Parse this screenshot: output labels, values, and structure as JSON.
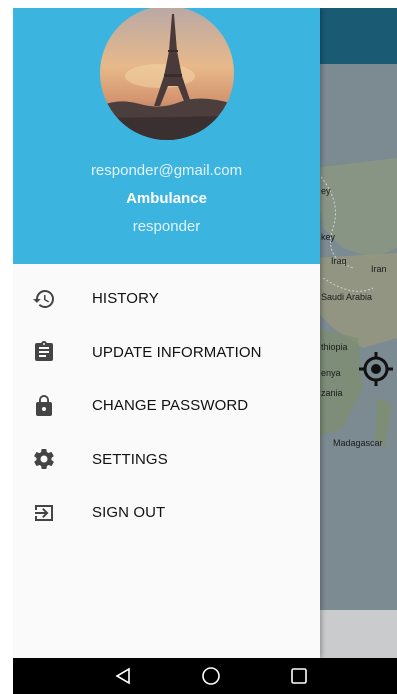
{
  "profile": {
    "email": "responder@gmail.com",
    "role": "Ambulance",
    "username": "responder",
    "avatar_subject": "eiffel-tower-sunset"
  },
  "menu": {
    "items": [
      {
        "label": "HISTORY",
        "icon": "history-icon"
      },
      {
        "label": "UPDATE INFORMATION",
        "icon": "clipboard-icon"
      },
      {
        "label": "CHANGE PASSWORD",
        "icon": "lock-icon"
      },
      {
        "label": "SETTINGS",
        "icon": "gear-icon"
      },
      {
        "label": "SIGN OUT",
        "icon": "sign-out-icon"
      }
    ]
  },
  "map": {
    "labels": [
      "ey",
      "key",
      "Iraq",
      "Iran",
      "Saudi Arabia",
      "thiopia",
      "enya",
      "zania",
      "Madagascar"
    ]
  },
  "colors": {
    "header": "#3cb4e0",
    "drawer_bg": "#fafafa",
    "icon": "#444444",
    "map_water": "#7c8a92",
    "map_topbar": "#1a5a73"
  },
  "navbar": {
    "buttons": [
      "back-icon",
      "home-icon",
      "recents-icon"
    ]
  }
}
